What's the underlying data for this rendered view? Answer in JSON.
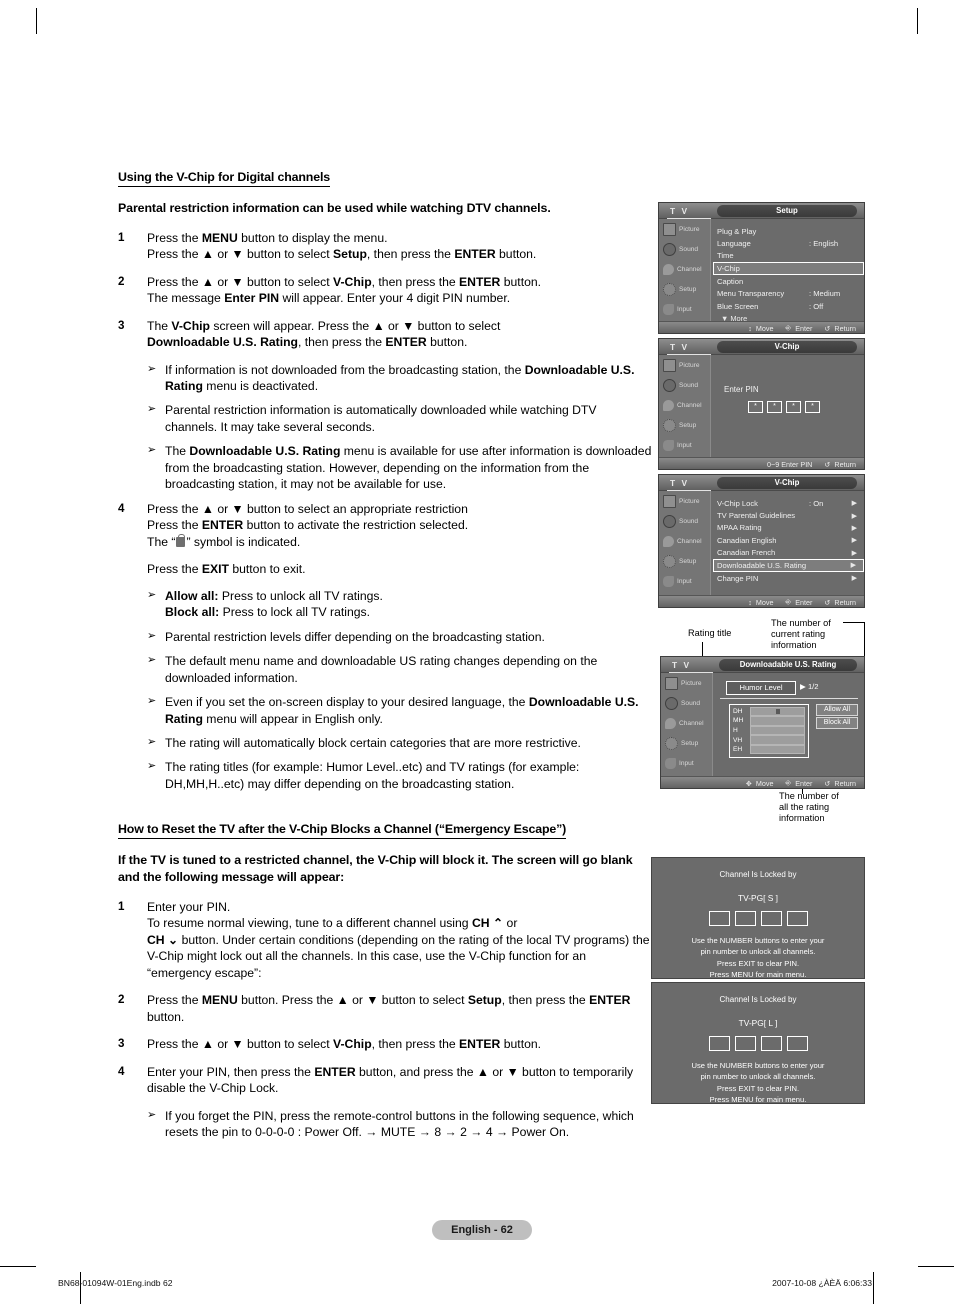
{
  "section": {
    "heading": "Using the V-Chip for Digital channels",
    "lead": "Parental restriction information can be used while watching DTV channels."
  },
  "steps": [
    {
      "num": "1",
      "lines": [
        "Press the <b>MENU</b> button to display the menu.",
        "Press the ▲ or ▼ button to select <b>Setup</b>, then press the <b>ENTER</b> button."
      ]
    },
    {
      "num": "2",
      "lines": [
        "Press the ▲ or ▼ button to select <b>V-Chip</b>, then press the <b>ENTER</b> button.",
        "The message <b>Enter PIN</b> will appear. Enter your 4 digit PIN number."
      ]
    },
    {
      "num": "3",
      "lines": [
        "The <b>V-Chip</b> screen will appear. Press the ▲ or ▼ button to select",
        "<b>Downloadable U.S. Rating</b>, then press the <b>ENTER</b> button."
      ]
    }
  ],
  "notes_group_1": [
    "If information is not downloaded from the broadcasting station, the <b>Downloadable U.S. Rating</b> menu is deactivated.",
    "Parental restriction information is automatically downloaded while watching DTV channels. It may take several seconds.",
    "The <b>Downloadable U.S. Rating</b> menu is available for use after information is downloaded from the broadcasting station. However, depending on the information from the broadcasting station, it may not be available for use."
  ],
  "step4": {
    "num": "4",
    "line1": "Press the ▲ or ▼ button to select an appropriate restriction",
    "line2": "Press the <b>ENTER</b> button to activate the restriction selected.",
    "line3_pre": "The “",
    "line3_post": "” symbol is indicated.",
    "exit_line": "Press the <b>EXIT</b> button to exit."
  },
  "notes_group_2": [
    "<b>Allow all:</b> Press to unlock all TV ratings.<br><b>Block all:</b> Press to lock all TV ratings.",
    "Parental restriction levels differ depending on the broadcasting station.",
    "The default menu name and downloadable US rating changes depending on the downloaded information.",
    "Even if you set the on-screen display to your desired language, the <b>Downloadable U.S. Rating</b> menu will appear in English only.",
    "The rating will automatically block certain categories that are more restrictive.",
    "The rating titles (for example: Humor Level..etc) and TV ratings (for example: DH,MH,H..etc) may differ depending on the broadcasting station."
  ],
  "section2": {
    "heading": "How to Reset the TV after the V-Chip Blocks a Channel (“Emergency Escape”)",
    "lead": "If the TV is tuned to a restricted channel, the V-Chip will block it. The screen will go blank and the following message will appear:"
  },
  "steps2": [
    {
      "num": "1",
      "html": "Enter your PIN.<br>To resume normal viewing, tune to a different channel using <b>CH ⌃</b> or<br><b>CH ⌄</b> button. Under certain conditions (depending on the rating of the local TV programs) the V-Chip might lock out all the channels. In this case, use the V-Chip function for an “emergency escape”:"
    },
    {
      "num": "2",
      "html": "Press the <b>MENU</b> button. Press the ▲ or ▼ button to select <b>Setup</b>, then press the <b>ENTER</b> button."
    },
    {
      "num": "3",
      "html": "Press the ▲ or ▼ button to select <b>V-Chip</b>, then press the <b>ENTER</b> button."
    },
    {
      "num": "4",
      "html": "Enter your PIN, then press the <b>ENTER</b> button, and press the ▲ or ▼ button to temporarily disable the V-Chip Lock."
    }
  ],
  "notes_group_3": [
    "If you forget the PIN, press the remote-control buttons in the following sequence, which resets the pin to 0-0-0-0 : Power Off. → MUTE → 8 → 2 → 4 → Power On."
  ],
  "osd_common": {
    "tv_label": "T V",
    "sidebar": [
      {
        "label": "Picture",
        "icon": "picture-icon"
      },
      {
        "label": "Sound",
        "icon": "sound-icon"
      },
      {
        "label": "Channel",
        "icon": "channel-icon"
      },
      {
        "label": "Setup",
        "icon": "setup-icon"
      },
      {
        "label": "Input",
        "icon": "input-icon"
      }
    ],
    "footer_move": "Move",
    "footer_enter": "Enter",
    "footer_return": "Return"
  },
  "osd_setup": {
    "title": "Setup",
    "rows": [
      {
        "label": "Plug & Play",
        "value": "",
        "selected": false
      },
      {
        "label": "Language",
        "value": ": English",
        "selected": false
      },
      {
        "label": "Time",
        "value": "",
        "selected": false
      },
      {
        "label": "V-Chip",
        "value": "",
        "selected": true
      },
      {
        "label": "Caption",
        "value": "",
        "selected": false
      },
      {
        "label": "Menu Transparency",
        "value": ": Medium",
        "selected": false
      },
      {
        "label": "Blue Screen",
        "value": ": Off",
        "selected": false
      }
    ],
    "more": "▼ More"
  },
  "osd_pin": {
    "title": "V-Chip",
    "enter_pin_label": "Enter PIN",
    "pin_digits": [
      "*",
      "*",
      "*",
      "*"
    ],
    "footer_hint": "0~9 Enter PIN",
    "footer_return": "Return"
  },
  "osd_vchip": {
    "title": "V-Chip",
    "rows": [
      {
        "label": "V-Chip Lock",
        "value": ": On",
        "selected": false
      },
      {
        "label": "TV Parental Guidelines",
        "value": "",
        "selected": false
      },
      {
        "label": "MPAA Rating",
        "value": "",
        "selected": false
      },
      {
        "label": "Canadian English",
        "value": "",
        "selected": false
      },
      {
        "label": "Canadian French",
        "value": "",
        "selected": false
      },
      {
        "label": "Downloadable U.S. Rating",
        "value": "",
        "selected": true
      },
      {
        "label": "Change PIN",
        "value": "",
        "selected": false
      }
    ]
  },
  "osd_downloadable": {
    "title": "Downloadable U.S. Rating",
    "rating_title": "Humor Level",
    "page_indicator": "▶ 1/2",
    "ratings": [
      {
        "code": "DH",
        "locked": true
      },
      {
        "code": "MH",
        "locked": false
      },
      {
        "code": "H",
        "locked": false
      },
      {
        "code": "VH",
        "locked": false
      },
      {
        "code": "EH",
        "locked": false
      }
    ],
    "allow_all": "Allow All",
    "block_all": "Block All"
  },
  "callouts": {
    "rating_title": "Rating title",
    "current_rating": "The number of\ncurrent rating\ninformation",
    "all_rating": "The number of\nall the rating\ninformation"
  },
  "locked_boxes": [
    {
      "title": "Channel Is Locked by",
      "rating": "TV-PG[ S ]",
      "lines": [
        "Use the NUMBER buttons to enter your",
        "pin number to unlock all channels.",
        "Press EXIT to clear PIN.",
        "Press MENU for main menu."
      ]
    },
    {
      "title": "Channel Is Locked by",
      "rating": "TV-PG[ L ]",
      "lines": [
        "Use the NUMBER buttons to enter your",
        "pin number to unlock all channels.",
        "Press EXIT to clear PIN.",
        "Press MENU for main menu."
      ]
    }
  ],
  "footer": {
    "page_pill": "English - 62",
    "file_info": "BN68-01094W-01Eng.indb   62",
    "timestamp": "2007-10-08   ¿ÀÈÄ 6:06:33"
  }
}
